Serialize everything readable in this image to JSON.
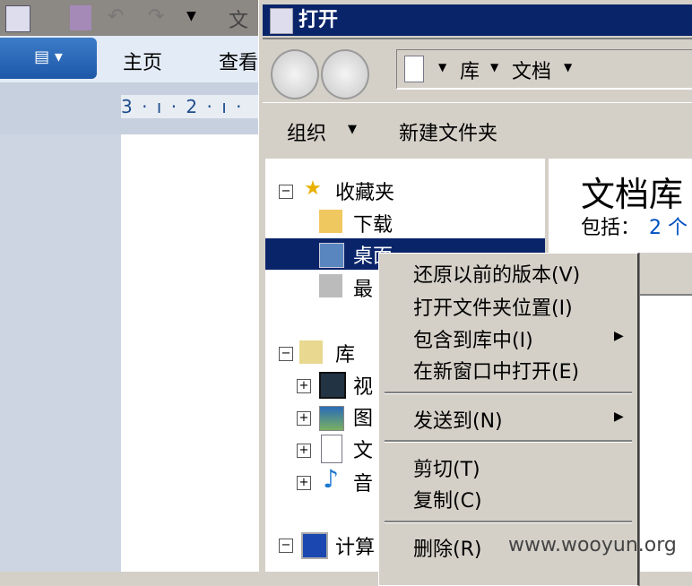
{
  "word": {
    "title_partial": "文",
    "file_menu_icon": "menu-icon",
    "tabs": [
      "主页",
      "查看"
    ],
    "ruler": "3 · ı · 2 · ı ·"
  },
  "dialog": {
    "title": "打开",
    "breadcrumb": [
      "库",
      "文档"
    ],
    "organize": "组织",
    "new_folder": "新建文件夹",
    "tree": [
      {
        "label": "收藏夹",
        "icon": "star-icon",
        "exp": "−"
      },
      {
        "label": "下载",
        "icon": "download-folder-icon"
      },
      {
        "label": "桌面",
        "icon": "desktop-icon",
        "selected": true
      },
      {
        "label": "最",
        "icon": "recent-places-icon"
      },
      {
        "label": "库",
        "icon": "library-icon",
        "exp": "−"
      },
      {
        "label": "视",
        "icon": "video-icon",
        "exp": "+"
      },
      {
        "label": "图",
        "icon": "picture-icon",
        "exp": "+"
      },
      {
        "label": "文",
        "icon": "document-icon",
        "exp": "+"
      },
      {
        "label": "音",
        "icon": "music-icon",
        "exp": "+"
      },
      {
        "label": "计算",
        "icon": "computer-icon",
        "exp": "−"
      }
    ],
    "library_title": "文档库",
    "includes_label": "包括：",
    "includes_value": "2 个"
  },
  "context_menu": {
    "items": [
      "还原以前的版本(V)",
      "打开文件夹位置(I)",
      "包含到库中(I)",
      "在新窗口中打开(E)",
      "发送到(N)",
      "剪切(T)",
      "复制(C)",
      "删除(R)"
    ]
  },
  "watermark": "www.wooyun.org"
}
